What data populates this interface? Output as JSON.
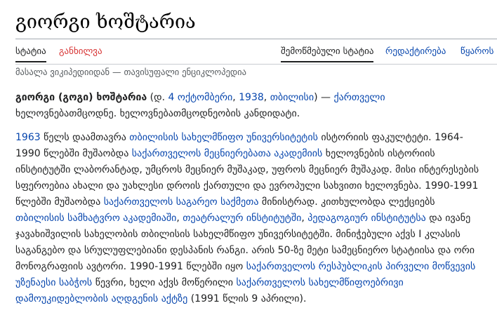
{
  "page": {
    "title": "გიორგი ხოშტარია",
    "tagline": "მასალა ვიკიპედიიდან — თავისუფალი ენციკლოპედია"
  },
  "tabs": {
    "article": "სტატია",
    "talk": "განხილვა",
    "read": "შემოწმებული სტატია",
    "edit": "რედაქტირება",
    "history": "წყაროს"
  },
  "lead": {
    "name": "გიორგი (გოგი) ხოშტარია",
    "t1": " (დ. ",
    "l_day": "4 ოქტომბერი",
    "t2": ", ",
    "l_year": "1938",
    "t3": ", ",
    "l_city": "თბილისი",
    "t4": ") — ",
    "l_georgian": "ქართველი",
    "t5": " ხელოვნებათმცოდნე. ხელოვნებათმცოდნეობის კანდიდატი."
  },
  "body": {
    "l1": "1963",
    "t1": " წელს დაამთავრა ",
    "l2": "თბილისის სახელმწიფო უნივერსიტეტის",
    "t2": " ისტორიის ფაკულტეტი. 1964-1990 წლებში მუშაობდა ",
    "l3": "საქართველოს მეცნიერებათა აკადემიის",
    "t3": " ხელოვნების ისტორიის ინსტიტუტში ლაბორანტად, უმცროს მეცნიერ მუშაკად, უფროს მეცნიერ მუშაკად. მისი ინტერესების სფეროებია ახალი და უახლესი დროის ქართული და ევროპული სახვითი ხელოვნება. 1990-1991 წლებში მუშაობდა ",
    "l4": "საქართველოს საგარეო საქმეთა",
    "t4": " მინისტრად. კითხულობდა ლექციებს ",
    "l5": "თბილისის სამხატვრო აკადემიაში",
    "t5": ", ",
    "l6": "თეატრალურ ინსტიტუტში",
    "t6": ", ",
    "l7": "პედაგოგიურ ინსტიტუტსა",
    "t7": " და ივანე ჯავახიშვილის სახელობის თბილისის სახელმწიფო უნივერსიტეტში. მინიჭებული აქვს I კლასის საგანგებო და სრულუფლებიანი დესპანის რანგი. არის 50-ზე მეტი სამეცნიერო სტატიისა და ორი მონოგრაფიის ავტორი. 1990-1991 წლებში იყო ",
    "l8": "საქართველოს რესპუბლიკის პირველი მოწვევის უზენაესი საბჭოს",
    "t8": " წევრი, ხელი აქვს მოწერილი ",
    "l9": "საქართველოს სახელმწიფოებრივი დამოუკიდებლობის აღდგენის აქტზე",
    "t9": " (1991 წლის 9 აპრილი)."
  }
}
